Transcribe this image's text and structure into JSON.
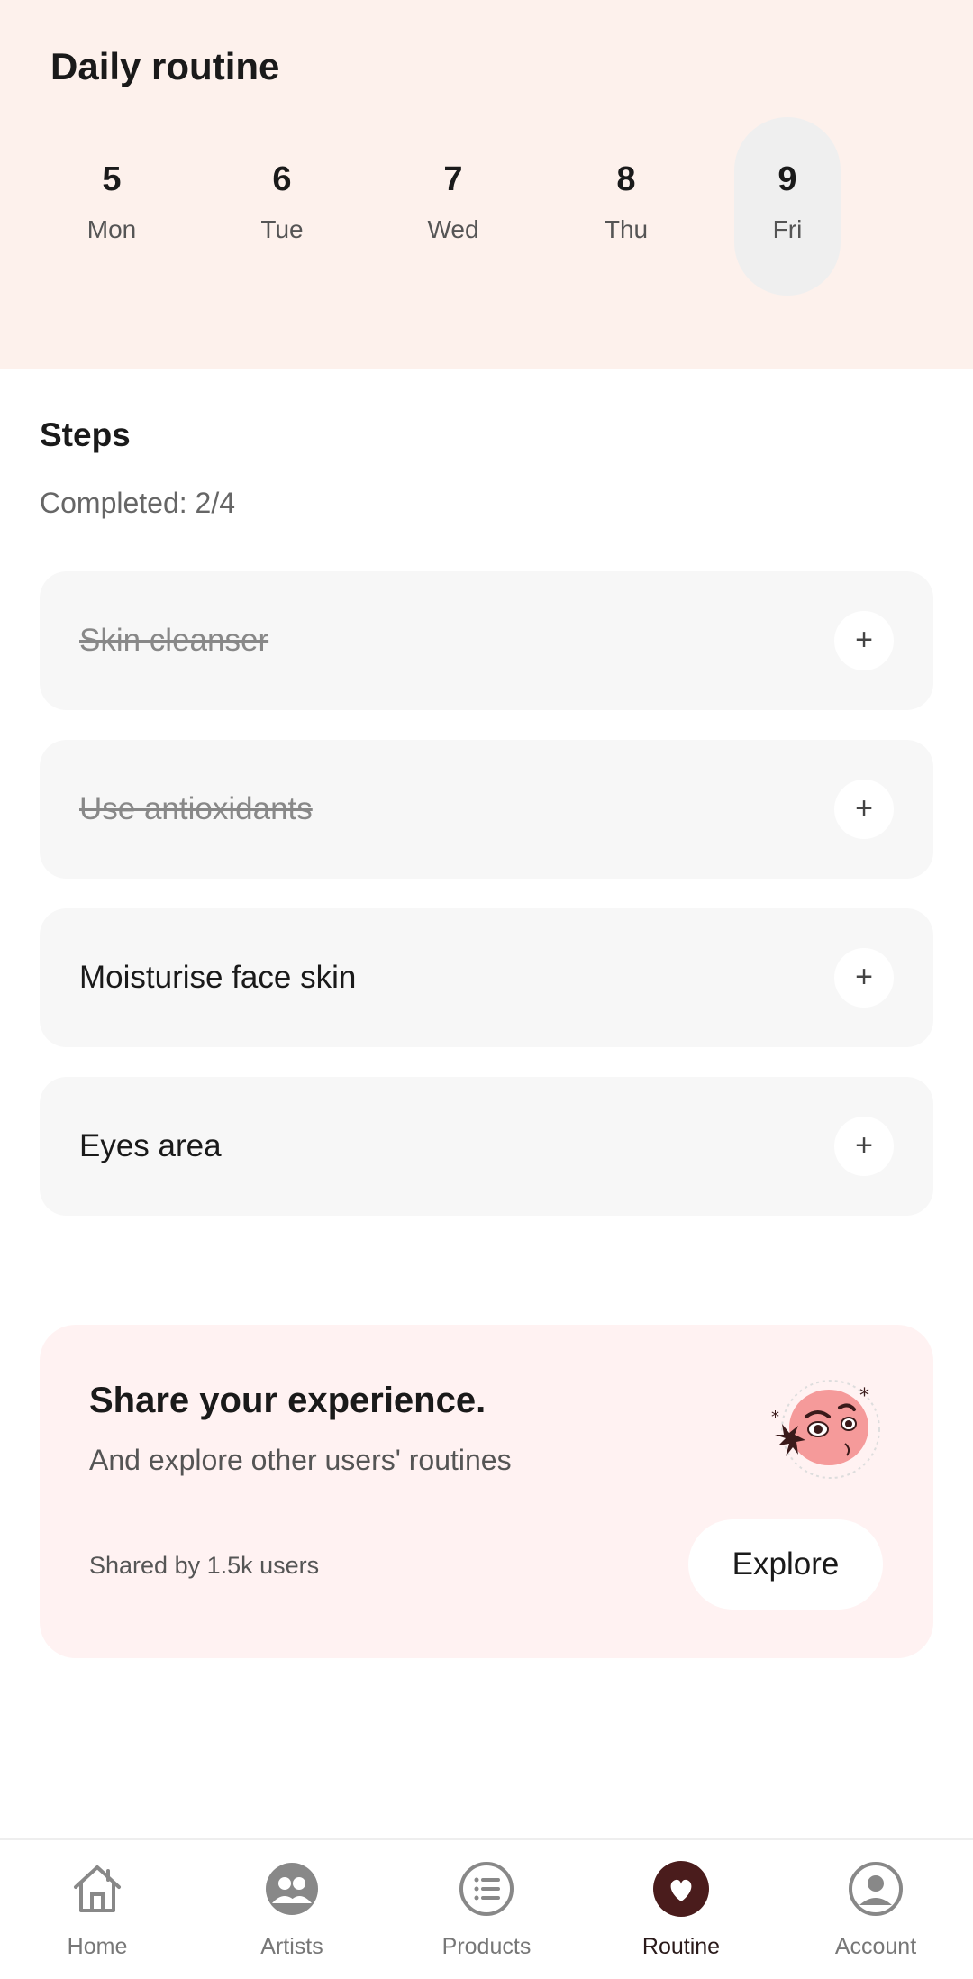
{
  "header": {
    "title": "Daily routine",
    "days": [
      {
        "num": "5",
        "name": "Mon",
        "selected": false
      },
      {
        "num": "6",
        "name": "Tue",
        "selected": false
      },
      {
        "num": "7",
        "name": "Wed",
        "selected": false
      },
      {
        "num": "8",
        "name": "Thu",
        "selected": false
      },
      {
        "num": "9",
        "name": "Fri",
        "selected": true
      }
    ]
  },
  "steps": {
    "title": "Steps",
    "completed": "Completed: 2/4",
    "items": [
      {
        "label": "Skin cleanser",
        "done": true,
        "add_icon": "plus-icon"
      },
      {
        "label": "Use antioxidants",
        "done": true,
        "add_icon": "plus-icon"
      },
      {
        "label": "Moisturise face skin",
        "done": false,
        "add_icon": "plus-icon"
      },
      {
        "label": "Eyes area",
        "done": false,
        "add_icon": "plus-icon"
      }
    ]
  },
  "share": {
    "title": "Share your experience.",
    "subtitle": "And explore other users' routines",
    "count": "Shared by 1.5k users",
    "button": "Explore",
    "illustration": "face-sticker-illustration"
  },
  "nav": {
    "items": [
      {
        "label": "Home",
        "icon": "home-icon",
        "active": false
      },
      {
        "label": "Artists",
        "icon": "artists-icon",
        "active": false
      },
      {
        "label": "Products",
        "icon": "list-icon",
        "active": false
      },
      {
        "label": "Routine",
        "icon": "heart-icon",
        "active": true
      },
      {
        "label": "Account",
        "icon": "account-icon",
        "active": false
      }
    ]
  },
  "colors": {
    "header_bg": "#fdf1ec",
    "card_bg": "#fff2f2",
    "step_bg": "#f7f7f7",
    "active_nav": "#4a1c1c"
  }
}
